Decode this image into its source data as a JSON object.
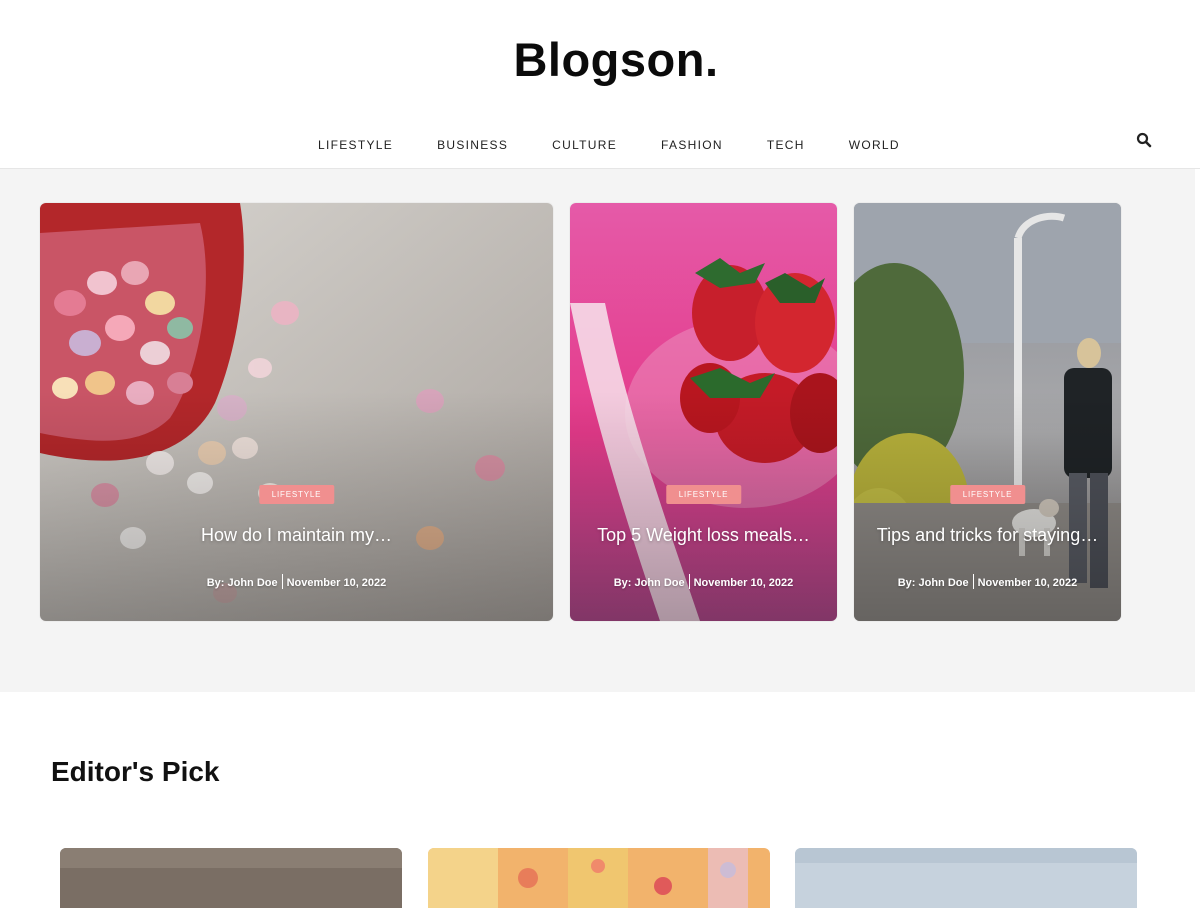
{
  "site": {
    "logo": "Blogson."
  },
  "nav": {
    "items": [
      "LIFESTYLE",
      "BUSINESS",
      "CULTURE",
      "FASHION",
      "TECH",
      "WORLD"
    ]
  },
  "featured": [
    {
      "category": "LIFESTYLE",
      "title": "How do I maintain my…",
      "author": "By: John Doe",
      "date": "November 10, 2022"
    },
    {
      "category": "LIFESTYLE",
      "title": "Top 5 Weight loss meals…",
      "author": "By: John Doe",
      "date": "November 10, 2022"
    },
    {
      "category": "LIFESTYLE",
      "title": "Tips and tricks for staying…",
      "author": "By: John Doe",
      "date": "November 10, 2022"
    }
  ],
  "editors_pick": {
    "title": "Editor's Pick"
  },
  "colors": {
    "badge": "#f08f8f",
    "featured_bg": "#f4f4f4"
  }
}
